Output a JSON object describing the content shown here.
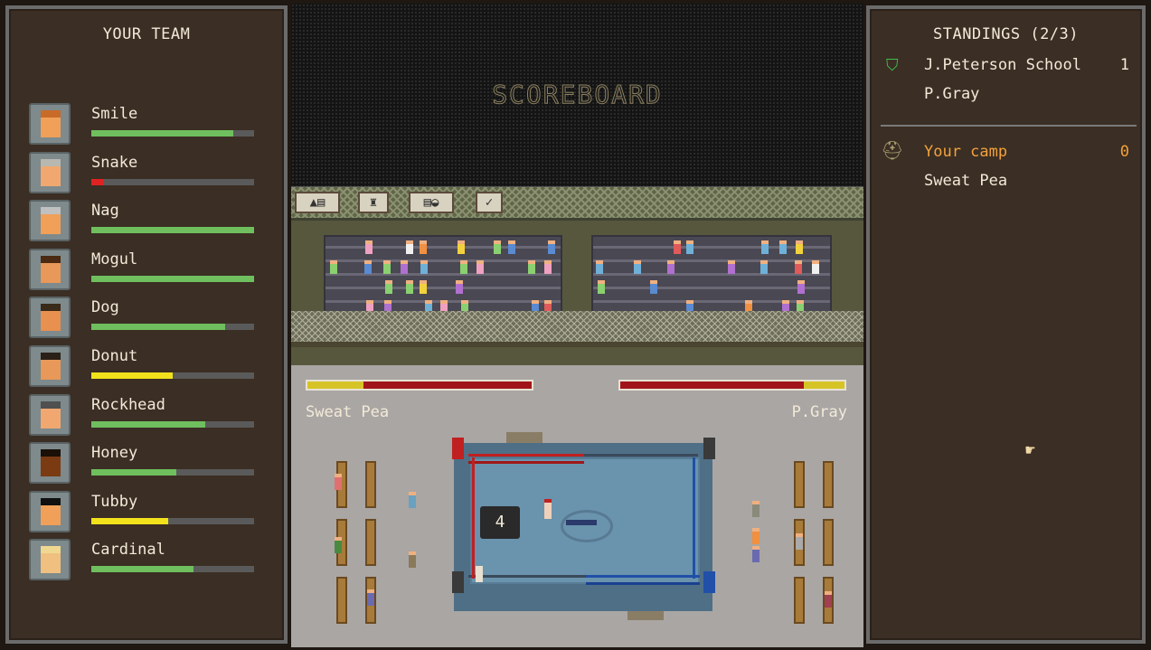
{
  "team_panel": {
    "title": "YOUR TEAM",
    "fighters": [
      {
        "name": "Smile",
        "health": 0.87,
        "bar_color": "#6fbf5e",
        "skin": "#f0a058",
        "hair": "#c86a28"
      },
      {
        "name": "Snake",
        "health": 0.07,
        "bar_color": "#e02222",
        "skin": "#f0a870",
        "hair": "#b8b8b0"
      },
      {
        "name": "Nag",
        "health": 1.0,
        "bar_color": "#6fbf5e",
        "skin": "#f0a058",
        "hair": "#c0c0c0"
      },
      {
        "name": "Mogul",
        "health": 1.0,
        "bar_color": "#6fbf5e",
        "skin": "#e89858",
        "hair": "#4a2a12"
      },
      {
        "name": "Dog",
        "health": 0.82,
        "bar_color": "#6fbf5e",
        "skin": "#e89050",
        "hair": "#3a2a1a"
      },
      {
        "name": "Donut",
        "health": 0.5,
        "bar_color": "#f2e21c",
        "skin": "#e89858",
        "hair": "#2a2018"
      },
      {
        "name": "Rockhead",
        "health": 0.7,
        "bar_color": "#6fbf5e",
        "skin": "#f0a870",
        "hair": "#505050"
      },
      {
        "name": "Honey",
        "health": 0.52,
        "bar_color": "#6fbf5e",
        "skin": "#7a3a12",
        "hair": "#1a1008"
      },
      {
        "name": "Tubby",
        "health": 0.47,
        "bar_color": "#f2e21c",
        "skin": "#f0a058",
        "hair": "#101010"
      },
      {
        "name": "Cardinal",
        "health": 0.63,
        "bar_color": "#6fbf5e",
        "skin": "#f0c080",
        "hair": "#f0d890"
      }
    ]
  },
  "scoreboard": {
    "text": "SCOREBOARD"
  },
  "match": {
    "left_fighter": "Sweat Pea",
    "left_health": 0.25,
    "right_fighter": "P.Gray",
    "right_health": 0.18,
    "countdown": "4"
  },
  "standings": {
    "title": "STANDINGS (2/3)",
    "teams": [
      {
        "team": "J.Peterson School",
        "fighter": "P.Gray",
        "score": "1",
        "name_color": "#f2ead8",
        "icon": "green-shield-icon"
      },
      {
        "team": "Your camp",
        "fighter": "Sweat Pea",
        "score": "0",
        "name_color": "#f2a23c",
        "icon": "camp-hat-icon"
      }
    ]
  }
}
